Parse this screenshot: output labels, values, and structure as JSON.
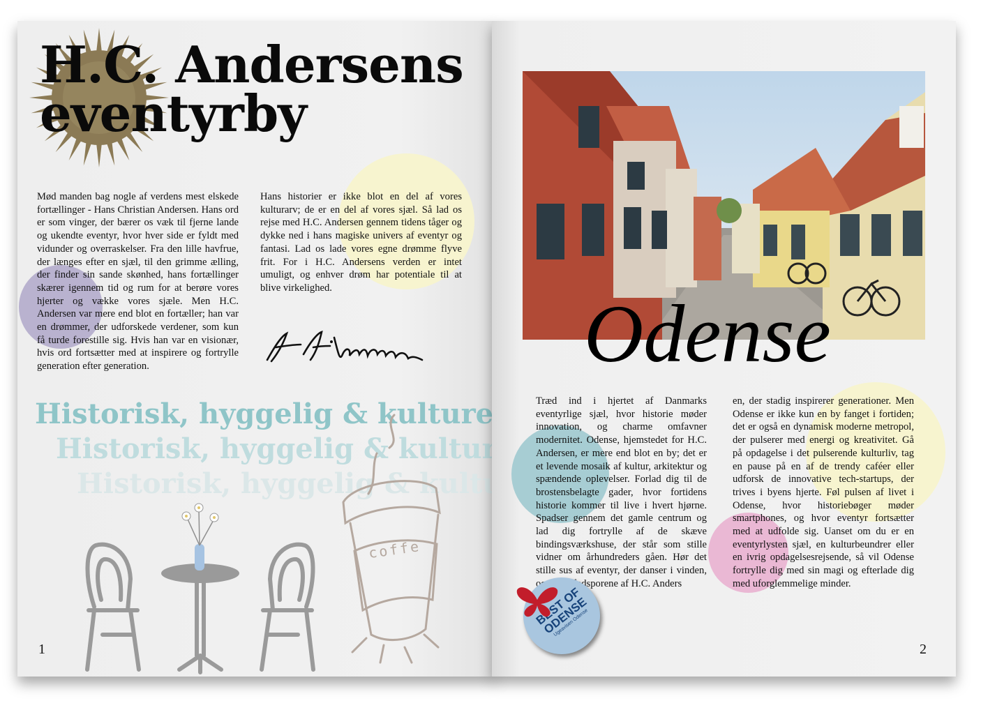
{
  "left_page": {
    "title_line1": "H.C. Andersens",
    "title_line2": "eventyrby",
    "col1": "Mød manden bag nogle af verdens mest elskede fortællinger - Hans Christian Andersen. Hans ord er som vinger, der bærer os væk til fjerne lande og ukendte eventyr, hvor hver side er fyldt med vidunder og overraskelser. Fra den lille havfrue, der længes efter en sjæl, til den grimme ælling, der finder sin sande skønhed, hans fortællinger skærer igennem tid og rum for at berøre vores hjerter og vække vores sjæle. Men H.C. Andersen var mere end blot en fortæller; han var en drømmer, der udforskede verdener, som kun få turde forestille sig. Hvis han var en visionær, hvis ord fortsætter med at inspirere og fortrylle generation efter generation.",
    "col2": "Hans historier er ikke blot en del af vores kulturarv; de er en del af vores sjæl. Så lad os rejse med H.C. Andersen gennem tidens tåger og dykke ned i hans magiske univers af eventyr og fantasi. Lad os lade vores egne drømme flyve frit. For i H.C. Andersens verden er intet umuligt, og enhver drøm har potentiale til at blive virkelighed.",
    "tagline": "Historisk, hyggelig & kulturel",
    "exclamation": "!",
    "coffee_label": "coffe",
    "page_number": "1"
  },
  "right_page": {
    "odense_title": "Odense",
    "col1": "Træd ind i hjertet af Danmarks eventyrlige sjæl, hvor historie møder innovation, og charme omfavner modernitet. Odense, hjemstedet for H.C. Andersen, er mere end blot en by; det er et levende mosaik af kultur, arkitektur og spændende oplevelser. Forlad dig til de brostensbelagte gader, hvor fortidens historie kommer til live i hvert hjørne. Spadser gennem det gamle centrum og lad dig fortrylle af de skæve bindingsværkshuse, der står som stille vidner om århundreders gåen. Hør det stille sus af eventyr, der danser i vinden, og følg i fodsporene af H.C. Anders",
    "col2": "en, der stadig inspirerer generationer. Men Odense er ikke kun en by fanget i fortiden; det er også en dynamisk moderne metropol, der pulserer med energi og kreativitet. Gå på opdagelse i det pulserende kulturliv, tag en pause på en af de trendy caféer eller udforsk de innovative tech-startups, der trives i byens hjerte. Føl pulsen af livet i Odense, hvor historiebøger møder smartphones, og hvor eventyr fortsætter med at udfolde sig. Uanset om du er en eventyrlysten sjæl, en kulturbeundrer eller en ivrig opdagelsesrejsende, så vil Odense fortrylle dig med sin magi og efterlade dig med uforglemmelige minder.",
    "badge_line1": "BEST OF",
    "badge_line2": "ODENSE",
    "badge_sub": "Ugeavisen Odense",
    "page_number": "2"
  },
  "colors": {
    "lavender_blob": "#b9b2cf",
    "yellow_blob": "#f7f4cf",
    "teal_blob": "#a7cdd3",
    "pink_blob": "#eab8d4",
    "tagline_teal": "#8fc5c8",
    "sun_brown": "#8b7a55",
    "badge_blue": "#a9c6df",
    "badge_text": "#17437a",
    "butterfly_red": "#c21d2b"
  },
  "icons": [
    "sun-icon",
    "signature-icon",
    "cafe-table-icon",
    "coffee-cup-icon",
    "butterfly-icon"
  ]
}
